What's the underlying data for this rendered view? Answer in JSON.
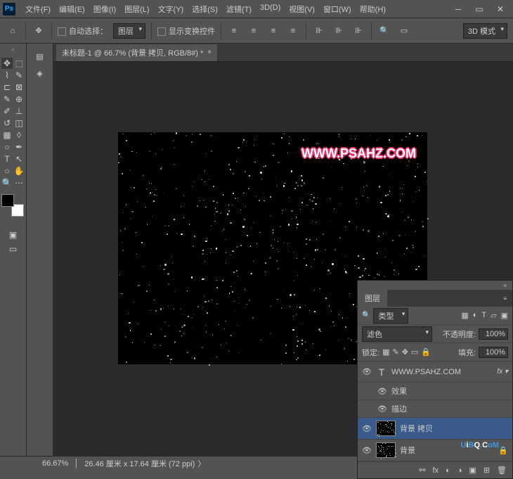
{
  "menubar": [
    "文件(F)",
    "编辑(E)",
    "图像(I)",
    "图层(L)",
    "文字(Y)",
    "选择(S)",
    "滤镜(T)",
    "3D(D)",
    "视图(V)",
    "窗口(W)",
    "帮助(H)"
  ],
  "ps_icon": "Ps",
  "optbar": {
    "auto_select": "自动选择：",
    "layer_dd": "图层",
    "show_transform": "显示变换控件",
    "mode3d": "3D 模式"
  },
  "tab": {
    "title": "未标题-1 @ 66.7% (背景 拷贝, RGB/8#) *"
  },
  "watermark": "WWW.PSAHZ.COM",
  "layers_panel": {
    "title": "图层",
    "kind_dd": "类型",
    "blend_dd": "滤色",
    "opacity_label": "不透明度:",
    "opacity_val": "100%",
    "lock_label": "锁定:",
    "fill_label": "填充:",
    "fill_val": "100%",
    "layers": [
      {
        "name": "WWW.PSAHZ.COM",
        "type": "text",
        "fx": true
      },
      {
        "name": "效果",
        "sub": true
      },
      {
        "name": "描边",
        "sub": true
      },
      {
        "name": "背景 拷贝",
        "selected": true
      },
      {
        "name": "背景",
        "locked": true
      }
    ]
  },
  "status": {
    "zoom": "66.67%",
    "dims": "26.46 厘米 x 17.64 厘米 (72 ppi)"
  },
  "uibq": "UiBQ.CoM"
}
